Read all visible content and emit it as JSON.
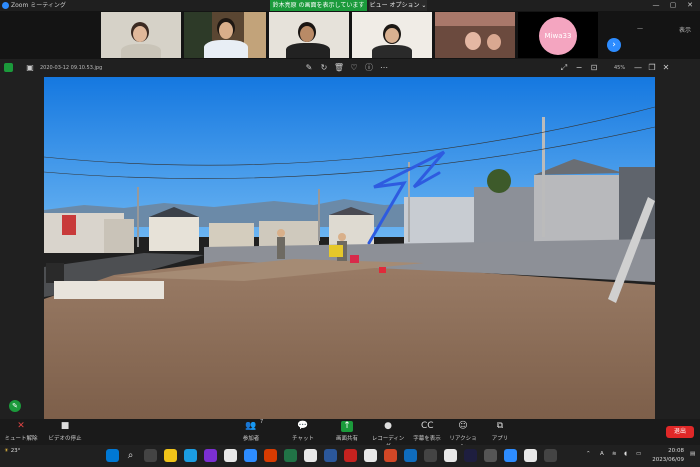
{
  "window": {
    "title": "Zoom ミーティング",
    "share_banner": "鈴木亮原 の画面を表示しています",
    "view_options": "ビュー オプション",
    "controls": {
      "minimize": "—",
      "maximize": "▢",
      "close": "✕"
    }
  },
  "gallery": {
    "tiles": [
      {
        "type": "video"
      },
      {
        "type": "video"
      },
      {
        "type": "video"
      },
      {
        "type": "video"
      },
      {
        "type": "video"
      },
      {
        "type": "name",
        "label": "Miwa33"
      }
    ],
    "top_right_label": "表示",
    "next_icon": "chevron-right-icon"
  },
  "viewer": {
    "filename": "2020-03-12 09.10.53.jpg",
    "zoom": "45%"
  },
  "meeting_controls": [
    {
      "label": "ミュート解除",
      "icon": "mic-muted-icon"
    },
    {
      "label": "ビデオの停止",
      "icon": "video-camera-icon"
    },
    {
      "label": "参加者",
      "icon": "participants-icon",
      "badge": "7"
    },
    {
      "label": "チャット",
      "icon": "chat-icon"
    },
    {
      "label": "画面共有",
      "icon": "share-screen-icon"
    },
    {
      "label": "レコーディング",
      "icon": "record-icon"
    },
    {
      "label": "字幕を表示",
      "icon": "captions-icon"
    },
    {
      "label": "リアクション",
      "icon": "reaction-icon"
    },
    {
      "label": "アプリ",
      "icon": "apps-icon"
    }
  ],
  "leave_label": "退出",
  "taskbar": {
    "weather_temp": "23°",
    "clock_time": "20:08",
    "clock_date": "2023/06/09",
    "language": "A"
  },
  "colors": {
    "zoom_blue": "#2d8cff",
    "share_green": "#1b9a3b",
    "leave_red": "#e02828",
    "sky": "#1e88e8",
    "dirt": "#8a6b55"
  }
}
